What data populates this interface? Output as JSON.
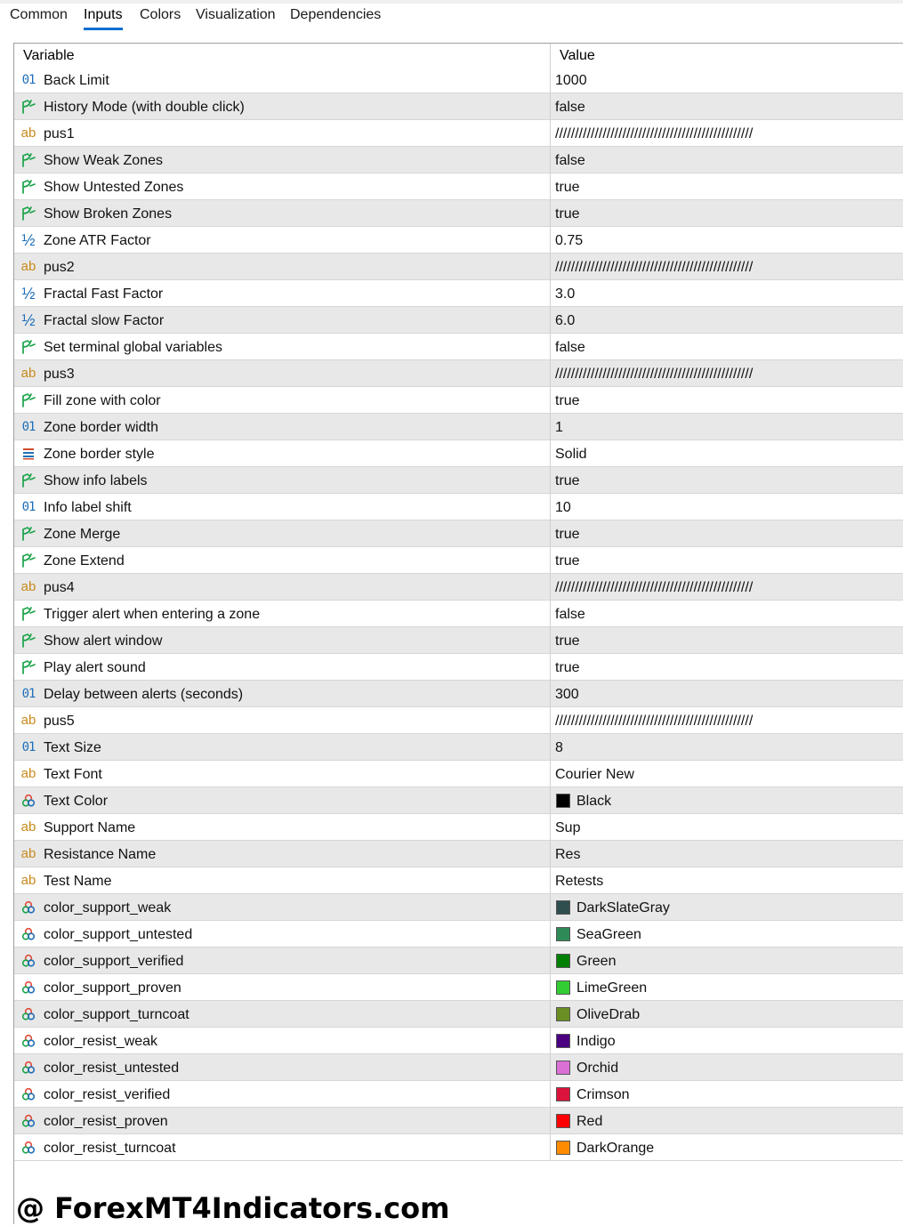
{
  "tabs": [
    {
      "label": "Common",
      "active": false
    },
    {
      "label": "Inputs",
      "active": true
    },
    {
      "label": "Colors",
      "active": false
    },
    {
      "label": "Visualization",
      "active": false
    },
    {
      "label": "Dependencies",
      "active": false
    }
  ],
  "table": {
    "col_variable": "Variable",
    "col_value": "Value",
    "rows": [
      {
        "icon": "int",
        "variable": "Back Limit",
        "value": "1000"
      },
      {
        "icon": "bool",
        "variable": "History Mode (with double click)",
        "value": "false"
      },
      {
        "icon": "string",
        "variable": "pus1",
        "value": "//////////////////////////////////////////////////"
      },
      {
        "icon": "bool",
        "variable": "Show Weak Zones",
        "value": "false"
      },
      {
        "icon": "bool",
        "variable": "Show Untested Zones",
        "value": "true"
      },
      {
        "icon": "bool",
        "variable": "Show Broken Zones",
        "value": "true"
      },
      {
        "icon": "double",
        "variable": "Zone ATR Factor",
        "value": "0.75"
      },
      {
        "icon": "string",
        "variable": "pus2",
        "value": "//////////////////////////////////////////////////"
      },
      {
        "icon": "double",
        "variable": "Fractal Fast Factor",
        "value": "3.0"
      },
      {
        "icon": "double",
        "variable": "Fractal slow Factor",
        "value": "6.0"
      },
      {
        "icon": "bool",
        "variable": "Set terminal global variables",
        "value": "false"
      },
      {
        "icon": "string",
        "variable": "pus3",
        "value": "//////////////////////////////////////////////////"
      },
      {
        "icon": "bool",
        "variable": "Fill zone with color",
        "value": "true"
      },
      {
        "icon": "int",
        "variable": "Zone border width",
        "value": "1"
      },
      {
        "icon": "enum",
        "variable": "Zone border style",
        "value": "Solid"
      },
      {
        "icon": "bool",
        "variable": "Show info labels",
        "value": "true"
      },
      {
        "icon": "int",
        "variable": "Info label shift",
        "value": "10"
      },
      {
        "icon": "bool",
        "variable": "Zone Merge",
        "value": "true"
      },
      {
        "icon": "bool",
        "variable": "Zone Extend",
        "value": "true"
      },
      {
        "icon": "string",
        "variable": "pus4",
        "value": "//////////////////////////////////////////////////"
      },
      {
        "icon": "bool",
        "variable": "Trigger alert when entering a zone",
        "value": "false"
      },
      {
        "icon": "bool",
        "variable": "Show alert window",
        "value": "true"
      },
      {
        "icon": "bool",
        "variable": "Play alert sound",
        "value": "true"
      },
      {
        "icon": "int",
        "variable": "Delay between alerts (seconds)",
        "value": "300"
      },
      {
        "icon": "string",
        "variable": "pus5",
        "value": "//////////////////////////////////////////////////"
      },
      {
        "icon": "int",
        "variable": "Text Size",
        "value": "8"
      },
      {
        "icon": "string",
        "variable": "Text Font",
        "value": "Courier New"
      },
      {
        "icon": "color",
        "variable": "Text Color",
        "value": "Black",
        "swatch": "#000000"
      },
      {
        "icon": "string",
        "variable": "Support Name",
        "value": "Sup"
      },
      {
        "icon": "string",
        "variable": "Resistance Name",
        "value": "Res"
      },
      {
        "icon": "string",
        "variable": "Test Name",
        "value": "Retests"
      },
      {
        "icon": "color",
        "variable": "color_support_weak",
        "value": "DarkSlateGray",
        "swatch": "#2f4f4f"
      },
      {
        "icon": "color",
        "variable": "color_support_untested",
        "value": "SeaGreen",
        "swatch": "#2e8b57"
      },
      {
        "icon": "color",
        "variable": "color_support_verified",
        "value": "Green",
        "swatch": "#008000"
      },
      {
        "icon": "color",
        "variable": "color_support_proven",
        "value": "LimeGreen",
        "swatch": "#32cd32"
      },
      {
        "icon": "color",
        "variable": "color_support_turncoat",
        "value": "OliveDrab",
        "swatch": "#6b8e23"
      },
      {
        "icon": "color",
        "variable": "color_resist_weak",
        "value": "Indigo",
        "swatch": "#4b0082"
      },
      {
        "icon": "color",
        "variable": "color_resist_untested",
        "value": "Orchid",
        "swatch": "#da70d6"
      },
      {
        "icon": "color",
        "variable": "color_resist_verified",
        "value": "Crimson",
        "swatch": "#dc143c"
      },
      {
        "icon": "color",
        "variable": "color_resist_proven",
        "value": "Red",
        "swatch": "#ff0000"
      },
      {
        "icon": "color",
        "variable": "color_resist_turncoat",
        "value": "DarkOrange",
        "swatch": "#ff8c00"
      }
    ]
  },
  "watermark": "@ ForexMT4Indicators.com",
  "colors": {
    "accent": "#0a6ed1",
    "row_alt": "#e8e8e8",
    "icon_int": "#1e6fb8",
    "icon_string": "#c8891a",
    "icon_bool": "#1aa34a"
  }
}
